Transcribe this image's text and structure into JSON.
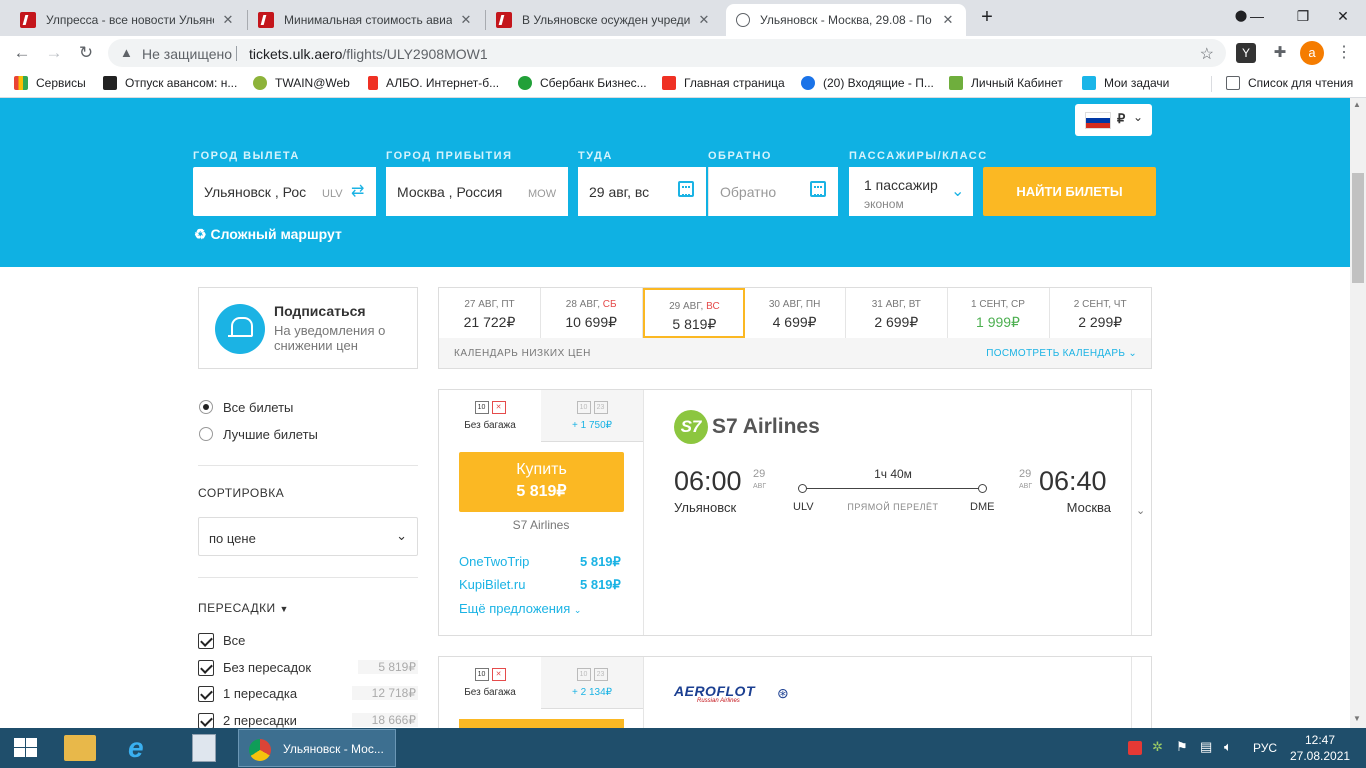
{
  "browser": {
    "tabs": [
      {
        "title": "Улпресса - все новости Ульянов"
      },
      {
        "title": "Минимальная стоимость авиаб"
      },
      {
        "title": "В Ульяновске осужден учредите"
      },
      {
        "title": "Ульяновск - Москва, 29.08 - По"
      }
    ],
    "new_tab": "+",
    "security": "Не защищено",
    "url_host": "tickets.ulk.aero",
    "url_path": "/flights/ULY2908MOW1",
    "profile_letter": "a",
    "bookmarks": [
      {
        "label": "Сервисы",
        "color": "#ea4335"
      },
      {
        "label": "Отпуск авансом: н...",
        "color": "#222222"
      },
      {
        "label": "TWAIN@Web",
        "color": "#8db33a"
      },
      {
        "label": "АЛБО. Интернет-б...",
        "color": "#ef3124"
      },
      {
        "label": "Сбербанк Бизнес...",
        "color": "#21a038"
      },
      {
        "label": "Главная страница",
        "color": "#ef3124"
      },
      {
        "label": "(20) Входящие - П...",
        "color": "#1a73e8"
      },
      {
        "label": "Личный Кабинет",
        "color": "#6fae3d"
      },
      {
        "label": "Мои задачи",
        "color": "#1ab5e8"
      }
    ],
    "reading_list": "Список для чтения"
  },
  "search": {
    "from_label": "ГОРОД ВЫЛЕТА",
    "from_value": "Ульяновск , Рос",
    "from_code": "ULV",
    "to_label": "ГОРОД ПРИБЫТИЯ",
    "to_value": "Москва , Россия",
    "to_code": "MOW",
    "depart_label": "ТУДА",
    "depart_value": "29 авг, вс",
    "return_label": "ОБРАТНО",
    "return_placeholder": "Обратно",
    "pax_label": "ПАССАЖИРЫ/КЛАСС",
    "pax_value": "1 пассажир",
    "class_value": "эконом",
    "search_button": "НАЙТИ БИЛЕТЫ",
    "complex_route": "Сложный маршрут",
    "currency": "₽"
  },
  "subscribe": {
    "title": "Подписаться",
    "subtitle": "На уведомления о снижении цен"
  },
  "calendar": {
    "days": [
      {
        "date": "27 АВГ, ",
        "dow": "ПТ",
        "price": "21 722₽",
        "weekend": false,
        "selected": false,
        "cheap": false
      },
      {
        "date": "28 АВГ, ",
        "dow": "СБ",
        "price": "10 699₽",
        "weekend": true,
        "selected": false,
        "cheap": false
      },
      {
        "date": "29 АВГ, ",
        "dow": "ВС",
        "price": "5 819₽",
        "weekend": true,
        "selected": true,
        "cheap": false
      },
      {
        "date": "30 АВГ, ",
        "dow": "ПН",
        "price": "4 699₽",
        "weekend": false,
        "selected": false,
        "cheap": false
      },
      {
        "date": "31 АВГ, ",
        "dow": "ВТ",
        "price": "2 699₽",
        "weekend": false,
        "selected": false,
        "cheap": false
      },
      {
        "date": "1 СЕНТ, ",
        "dow": "СР",
        "price": "1 999₽",
        "weekend": false,
        "selected": false,
        "cheap": true
      },
      {
        "date": "2 СЕНТ, ",
        "dow": "ЧТ",
        "price": "2 299₽",
        "weekend": false,
        "selected": false,
        "cheap": false
      }
    ],
    "footer_left": "КАЛЕНДАРЬ НИЗКИХ ЦЕН",
    "footer_right": "ПОСМОТРЕТЬ КАЛЕНДАРЬ"
  },
  "filters": {
    "all_tickets": "Все билеты",
    "best_tickets": "Лучшие билеты",
    "sort_label": "СОРТИРОВКА",
    "sort_value": "по цене",
    "transfers_label": "ПЕРЕСАДКИ",
    "transfers": [
      {
        "label": "Все",
        "price": ""
      },
      {
        "label": "Без пересадок",
        "price": "5 819₽"
      },
      {
        "label": "1 пересадка",
        "price": "12 718₽"
      },
      {
        "label": "2 пересадки",
        "price": "18 666₽"
      }
    ]
  },
  "tickets": [
    {
      "no_baggage": "Без багажа",
      "baggage_extra": "+ 1 750₽",
      "buy_label": "Купить",
      "price": "5 819₽",
      "seller": "S7 Airlines",
      "offers": [
        {
          "name": "OneTwoTrip",
          "price": "5 819₽"
        },
        {
          "name": "KupiBilet.ru",
          "price": "5 819₽"
        }
      ],
      "more_offers": "Ещё предложения",
      "airline": "S7 Airlines",
      "dep_time": "06:00",
      "dep_day": "29",
      "dep_month": "АВГ",
      "dep_city": "Ульяновск",
      "dep_code": "ULV",
      "duration": "1ч 40м",
      "direct": "ПРЯМОЙ ПЕРЕЛЁТ",
      "arr_code": "DME",
      "arr_time": "06:40",
      "arr_day": "29",
      "arr_month": "АВГ",
      "arr_city": "Москва"
    },
    {
      "no_baggage": "Без багажа",
      "baggage_extra": "+ 2 134₽",
      "airline": "AEROFLOT",
      "airline_sub": "Russian Airlines"
    }
  ],
  "taskbar": {
    "app_label": "Ульяновск - Мос...",
    "lang": "РУС",
    "time": "12:47",
    "date": "27.08.2021"
  }
}
